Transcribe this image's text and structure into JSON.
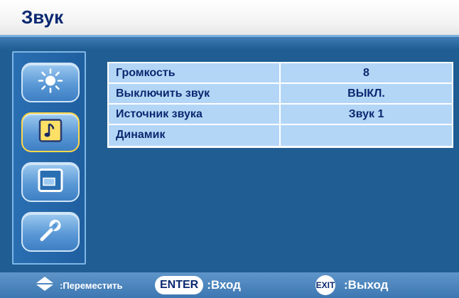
{
  "header": {
    "title": "Звук"
  },
  "sidebar": {
    "items": [
      {
        "icon": "brightness-icon",
        "active": false
      },
      {
        "icon": "music-note-icon",
        "active": true
      },
      {
        "icon": "screen-icon",
        "active": false
      },
      {
        "icon": "wrench-icon",
        "active": false
      }
    ]
  },
  "menu": {
    "rows": [
      {
        "label": "Громкость",
        "value": "8"
      },
      {
        "label": "Выключить звук",
        "value": "ВЫКЛ."
      },
      {
        "label": "Источник звука",
        "value": "Звук 1"
      },
      {
        "label": "Динамик",
        "value": ""
      }
    ]
  },
  "footer": {
    "move_label": ":Переместить",
    "enter_key": "ENTER",
    "enter_label": ":Вход",
    "exit_key": "EXIT",
    "exit_label": ":Выход"
  },
  "colors": {
    "background": "#1f5d92",
    "cell": "#b3d6f6",
    "text": "#0a2870",
    "active_border": "#ffd84a"
  }
}
